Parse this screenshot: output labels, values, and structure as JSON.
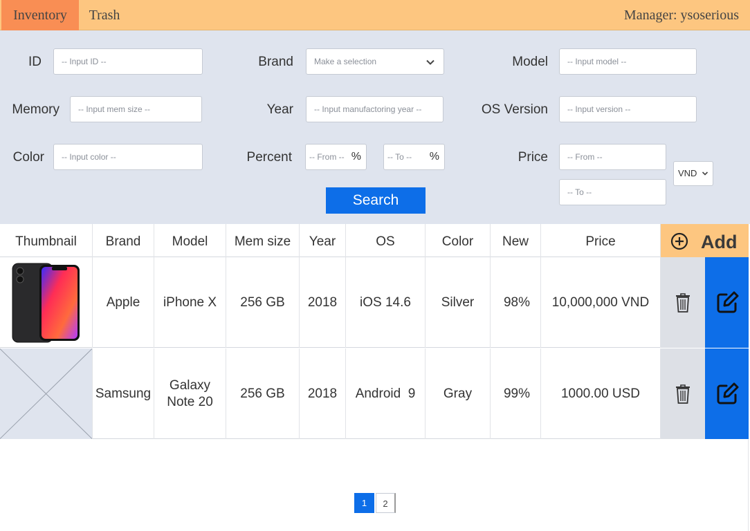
{
  "nav": {
    "tabs": [
      {
        "label": "Inventory",
        "active": true
      },
      {
        "label": "Trash",
        "active": false
      }
    ],
    "manager": "Manager: ysoserious"
  },
  "filters": {
    "id": {
      "label": "ID",
      "placeholder": "-- Input ID --"
    },
    "brand": {
      "label": "Brand",
      "placeholder": "Make a selection"
    },
    "model": {
      "label": "Model",
      "placeholder": "-- Input model --"
    },
    "memory": {
      "label": "Memory",
      "placeholder": "-- Input mem size --"
    },
    "year": {
      "label": "Year",
      "placeholder": "-- Input manufactoring year --"
    },
    "os_version": {
      "label": "OS Version",
      "placeholder": "-- Input version --"
    },
    "color": {
      "label": "Color",
      "placeholder": "-- Input color --"
    },
    "percent": {
      "label": "Percent",
      "from_placeholder": "-- From --",
      "to_placeholder": "-- To --",
      "unit": "%"
    },
    "price": {
      "label": "Price",
      "from_placeholder": "-- From --",
      "to_placeholder": "-- To --",
      "currency": "VND"
    },
    "search_label": "Search"
  },
  "table": {
    "headers": [
      "Thumbnail",
      "Brand",
      "Model",
      "Mem size",
      "Year",
      "OS",
      "Color",
      "New",
      "Price"
    ],
    "add_label": "Add",
    "rows": [
      {
        "brand": "Apple",
        "model": "iPhone X",
        "mem": "256 GB",
        "year": "2018",
        "os": "iOS 14.6",
        "color": "Silver",
        "new": "98%",
        "price": "10,000,000 VND",
        "thumbnail": "phone-image"
      },
      {
        "brand": "Samsung",
        "model": "Galaxy Note 20",
        "mem": "256 GB",
        "year": "2018",
        "os": "Android  9",
        "color": "Gray",
        "new": "99%",
        "price": "1000.00 USD",
        "thumbnail": "placeholder-image"
      }
    ]
  },
  "pagination": {
    "pages": [
      "1",
      "2"
    ],
    "current": "1"
  },
  "colors": {
    "nav_bg": "#fdc680",
    "active_tab": "#f98e54",
    "filter_bg": "#dfe4ee",
    "primary": "#0d6ee8",
    "delete_bg": "#dde0e6"
  },
  "icons": [
    "chevron-down-icon",
    "plus-circle-icon",
    "trash-icon",
    "edit-icon"
  ]
}
